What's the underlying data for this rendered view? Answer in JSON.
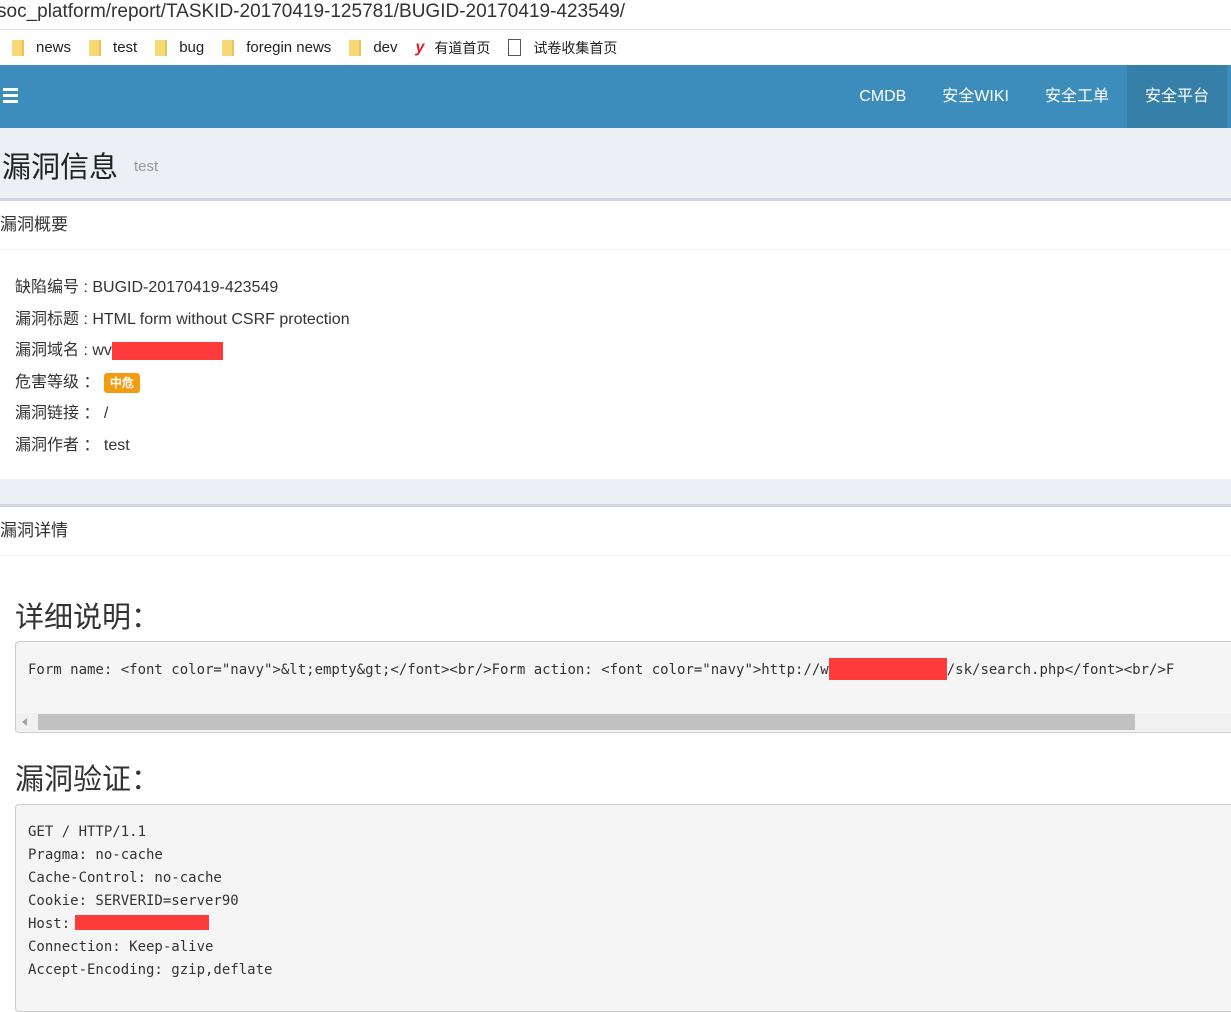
{
  "browser": {
    "url": "soc_platform/report/TASKID-20170419-125781/BUGID-20170419-423549/",
    "bookmarks": [
      {
        "label": "news",
        "icon": "folder-icon"
      },
      {
        "label": "test",
        "icon": "folder-icon"
      },
      {
        "label": "bug",
        "icon": "folder-icon"
      },
      {
        "label": "foregin news",
        "icon": "folder-icon"
      },
      {
        "label": "dev",
        "icon": "folder-icon"
      },
      {
        "label": "有道首页",
        "icon": "youdao-icon"
      },
      {
        "label": "试卷收集首页",
        "icon": "page-icon"
      }
    ]
  },
  "navbar": {
    "items": [
      "CMDB",
      "安全WIKI",
      "安全工单",
      "安全平台"
    ],
    "active": "安全平台",
    "color": "#3c8dbc"
  },
  "header": {
    "title": "漏洞信息",
    "subtitle": "test"
  },
  "summary": {
    "title": "漏洞概要",
    "bug_id_label": "缺陷编号 : ",
    "bug_id": "BUGID-20170419-423549",
    "vuln_title_label": "漏洞标题 : ",
    "vuln_title": "HTML form without CSRF protection",
    "domain_label": "漏洞域名 : ",
    "domain_visible": "wv",
    "severity_label": "危害等级 ： ",
    "severity": "中危",
    "severity_color": "#f39c12",
    "link_label": "漏洞链接 ： ",
    "link": "/",
    "author_label": "漏洞作者 ： ",
    "author": "test"
  },
  "details": {
    "title": "漏洞详情",
    "description_heading": "详细说明：",
    "description_code_prefix": "Form name: <font color=\"navy\">&lt;empty&gt;</font><br/>Form action: <font color=\"navy\">http://w",
    "description_code_suffix": "/sk/search.php</font><br/>F",
    "verification_heading": "漏洞验证：",
    "request_lines": [
      "GET / HTTP/1.1",
      "Pragma: no-cache",
      "Cache-Control: no-cache",
      "Cookie: SERVERID=server90",
      "Host: ",
      "Connection: Keep-alive",
      "Accept-Encoding: gzip,deflate"
    ]
  }
}
